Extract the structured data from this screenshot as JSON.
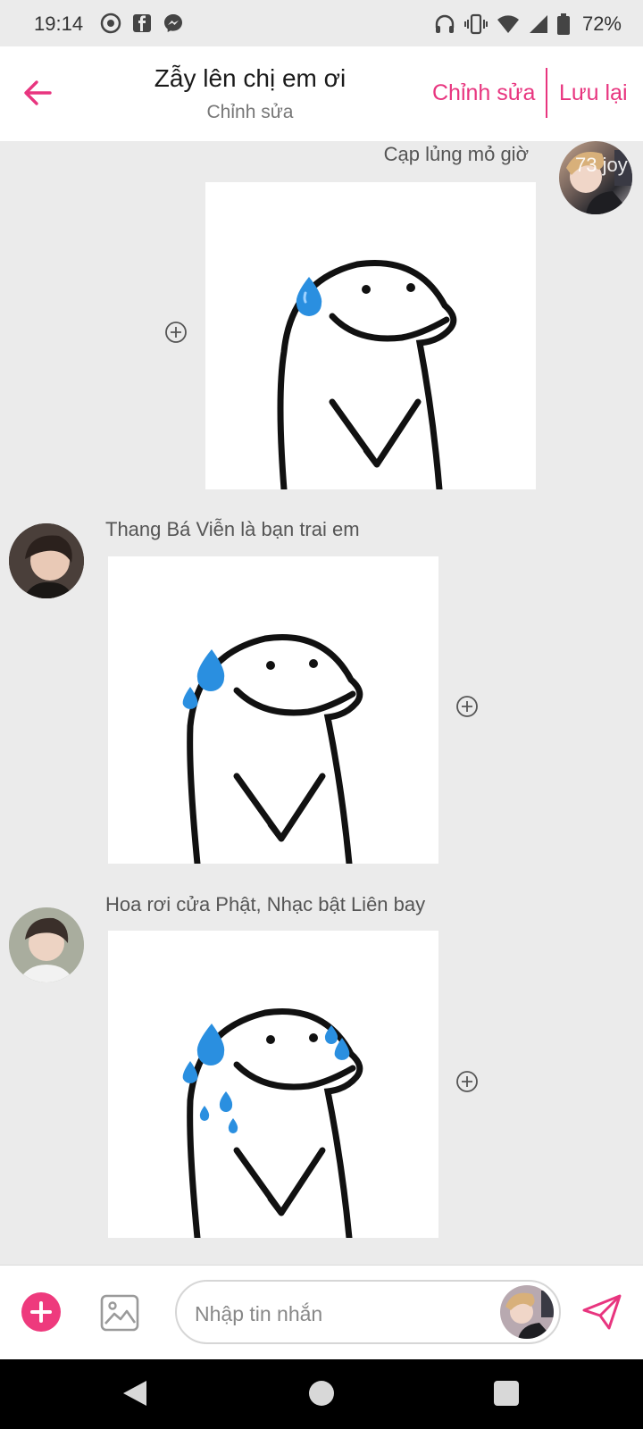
{
  "status_bar": {
    "time": "19:14",
    "battery_percent": "72%",
    "left_icons": [
      "eye-icon",
      "facebook-icon",
      "messenger-icon"
    ],
    "right_icons": [
      "headphones-icon",
      "vibrate-icon",
      "wifi-icon",
      "signal-icon",
      "battery-icon"
    ]
  },
  "header": {
    "title": "Zẫy lên chị em ơi",
    "subtitle": "Chỉnh sửa",
    "edit_label": "Chỉnh sửa",
    "save_label": "Lưu lại",
    "accent_color": "#e8357f"
  },
  "messages": [
    {
      "name": "Cạp lủng mỏ giờ",
      "avatar_text": "73 joy",
      "side": "right",
      "sticker": "sweat-blob-1-drop"
    },
    {
      "name": "Thang Bá Viễn là bạn trai em",
      "side": "left",
      "sticker": "sweat-blob-2-drops"
    },
    {
      "name": "Hoa rơi cửa Phật, Nhạc bật Liên bay",
      "side": "left",
      "sticker": "sweat-blob-many-drops"
    }
  ],
  "composer": {
    "placeholder": "Nhập tin nhắn",
    "plus_color": "#ee3a7d"
  }
}
